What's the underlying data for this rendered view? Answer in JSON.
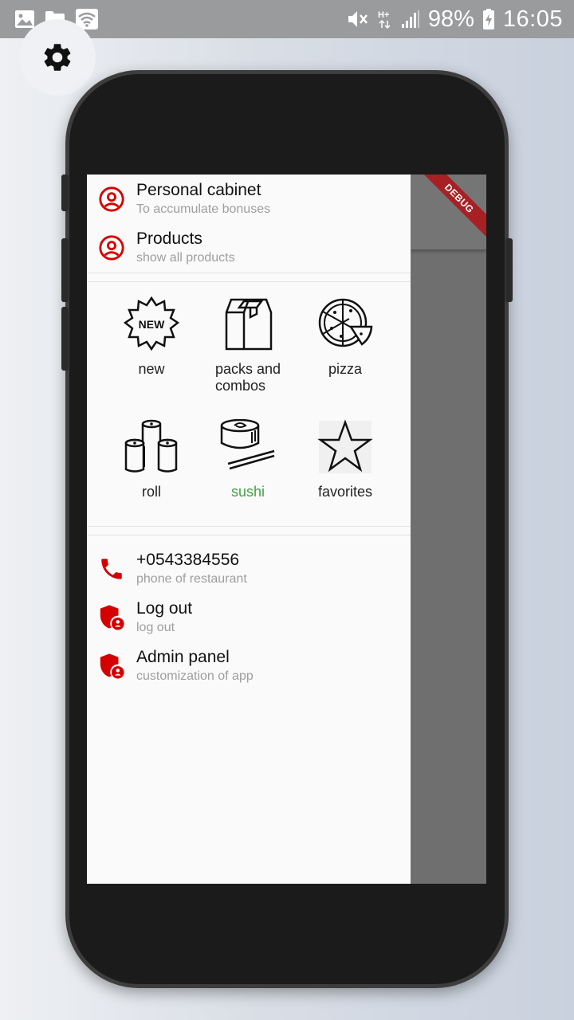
{
  "status_bar": {
    "battery": "98%",
    "time": "16:05",
    "icons": [
      "image-icon",
      "folder-icon",
      "wifi-icon",
      "mute-icon",
      "hplus-icon",
      "signal-icon",
      "battery-charging-icon"
    ]
  },
  "settings_button": {
    "icon": "gear-icon"
  },
  "debug_banner": "DEBUG",
  "drawer": {
    "top_items": [
      {
        "title": "Personal cabinet",
        "subtitle": "To accumulate bonuses",
        "icon": "account-circle-icon"
      },
      {
        "title": "Products",
        "subtitle": "show all products",
        "icon": "account-circle-icon"
      }
    ],
    "categories": [
      {
        "label": "new",
        "icon": "new-badge-icon",
        "active": false
      },
      {
        "label": "packs and combos",
        "icon": "package-box-icon",
        "active": false
      },
      {
        "label": "pizza",
        "icon": "pizza-icon",
        "active": false
      },
      {
        "label": "roll",
        "icon": "rolls-icon",
        "active": false
      },
      {
        "label": "sushi",
        "icon": "sushi-chopsticks-icon",
        "active": true
      },
      {
        "label": "favorites",
        "icon": "star-icon",
        "active": false
      }
    ],
    "bottom_items": [
      {
        "title": "+0543384556",
        "subtitle": "phone of restaurant",
        "icon": "phone-icon"
      },
      {
        "title": "Log out",
        "subtitle": "log out",
        "icon": "admin-shield-icon"
      },
      {
        "title": "Admin panel",
        "subtitle": "customization of app",
        "icon": "admin-shield-icon"
      }
    ]
  },
  "colors": {
    "accent_red": "#d50000",
    "active_green": "#43a047",
    "drawer_bg": "#fafafa",
    "scrim": "#6f6f6f"
  }
}
